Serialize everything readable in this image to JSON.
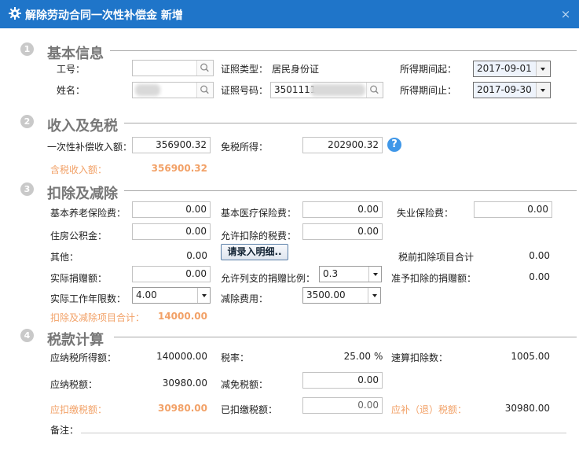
{
  "window": {
    "title": "解除劳动合同一次性补偿金 新增",
    "close": "×"
  },
  "sections": {
    "s1": {
      "num": "1",
      "title": "基本信息"
    },
    "s2": {
      "num": "2",
      "title": "收入及免税"
    },
    "s3": {
      "num": "3",
      "title": "扣除及减除"
    },
    "s4": {
      "num": "4",
      "title": "税款计算"
    }
  },
  "basic": {
    "employee_id_label": "工号：",
    "employee_id_value": "",
    "name_label": "姓名：",
    "id_type_label": "证照类型：",
    "id_type_value": "居民身份证",
    "id_number_label": "证照号码：",
    "id_number_value": "3501111",
    "period_start_label": "所得期间起：",
    "period_start_value": "2017-09-01",
    "period_end_label": "所得期间止：",
    "period_end_value": "2017-09-30"
  },
  "income": {
    "lump_sum_label": "一次性补偿收入额：",
    "lump_sum_value": "356900.32",
    "tax_exempt_label": "免税所得：",
    "tax_exempt_value": "202900.32",
    "help_icon": "?",
    "taxable_income_label": "含税收入额：",
    "taxable_income_value": "356900.32"
  },
  "deduct": {
    "pension_label": "基本养老保险费：",
    "pension_value": "0.00",
    "medical_label": "基本医疗保险费：",
    "medical_value": "0.00",
    "unemployment_label": "失业保险费：",
    "unemployment_value": "0.00",
    "housing_label": "住房公积金：",
    "housing_value": "0.00",
    "allowed_tax_label": "允许扣除的税费：",
    "allowed_tax_value": "0.00",
    "other_label": "其他：",
    "other_value": "0.00",
    "detail_button": "请录入明细..",
    "pretax_total_label": "税前扣除项目合计",
    "pretax_total_value": "0.00",
    "donation_label": "实际捐赠额：",
    "donation_value": "0.00",
    "donation_ratio_label": "允许列支的捐赠比例：",
    "donation_ratio_value": "0.3",
    "allowed_donation_label": "准予扣除的捐赠额：",
    "allowed_donation_value": "0.00",
    "work_years_label": "实际工作年限数：",
    "work_years_value": "4.00",
    "reduction_label": "减除费用：",
    "reduction_value": "3500.00",
    "deduct_total_label": "扣除及减除项目合计：",
    "deduct_total_value": "14000.00"
  },
  "tax": {
    "taxable_label": "应纳税所得额：",
    "taxable_value": "140000.00",
    "rate_label": "税率：",
    "rate_value": "25.00",
    "rate_unit": "%",
    "quick_deduct_label": "速算扣除数：",
    "quick_deduct_value": "1005.00",
    "tax_payable_label": "应纳税额：",
    "tax_payable_value": "30980.00",
    "tax_relief_label": "减免税额：",
    "tax_relief_value": "0.00",
    "withhold_label": "应扣缴税额：",
    "withhold_value": "30980.00",
    "withheld_label": "已扣缴税额：",
    "withheld_value": "0.00",
    "refund_label": "应补（退）税额：",
    "refund_value": "30980.00",
    "note_label": "备注："
  },
  "colors": {
    "titlebar": "#1f75c9",
    "orange": "#f2a167",
    "help": "#3f97e8"
  }
}
